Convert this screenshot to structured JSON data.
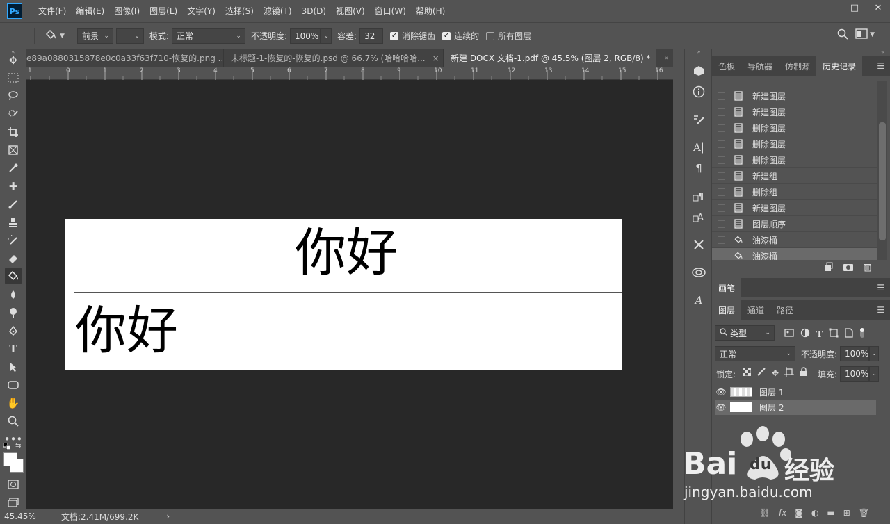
{
  "app": {
    "logo": "Ps"
  },
  "menu": [
    "文件(F)",
    "编辑(E)",
    "图像(I)",
    "图层(L)",
    "文字(Y)",
    "选择(S)",
    "滤镜(T)",
    "3D(D)",
    "视图(V)",
    "窗口(W)",
    "帮助(H)"
  ],
  "window_controls": {
    "minimize": "—",
    "maximize": "□",
    "close": "✕"
  },
  "options": {
    "fill_source": "前景",
    "mode_label": "模式:",
    "mode_value": "正常",
    "opacity_label": "不透明度:",
    "opacity_value": "100%",
    "tolerance_label": "容差:",
    "tolerance_value": "32",
    "antialias_label": "消除锯齿",
    "antialias_checked": true,
    "contiguous_label": "连续的",
    "contiguous_checked": true,
    "all_layers_label": "所有图层",
    "all_layers_checked": false
  },
  "tabs": [
    {
      "label": "e89a0880315878e0c0a33f63f710-恢复的.png ...",
      "close": "×",
      "active": false
    },
    {
      "label": "未标题-1-恢复的-恢复的.psd @ 66.7% (哈哈哈哈...",
      "close": "×",
      "active": false
    },
    {
      "label": "新建 DOCX 文档-1.pdf @ 45.5% (图层 2, RGB/8) *",
      "close": "×",
      "active": true
    }
  ],
  "ruler_ticks": [
    "1",
    "0",
    "1",
    "2",
    "3",
    "4",
    "5",
    "6",
    "7",
    "8",
    "9",
    "10",
    "11",
    "12",
    "13",
    "14",
    "15",
    "16"
  ],
  "document": {
    "title_text": "你好",
    "body_text": "你好"
  },
  "status": {
    "zoom": "45.45%",
    "doc_info": "文档:2.41M/699.2K",
    "arrow": "›"
  },
  "history_panel": {
    "tabs": [
      "色板",
      "导航器",
      "仿制源",
      "历史记录"
    ],
    "active_tab": "历史记录",
    "items": [
      "新建图层",
      "新建图层",
      "删除图层",
      "删除图层",
      "删除图层",
      "新建组",
      "删除组",
      "新建图层",
      "图层顺序",
      "油漆桶",
      "油漆桶"
    ],
    "selected_index": 10
  },
  "brush_panel": {
    "title": "画笔"
  },
  "layers_panel": {
    "tabs": [
      "图层",
      "通道",
      "路径"
    ],
    "active_tab": "图层",
    "filter_label": "类型",
    "blend_mode": "正常",
    "opacity_label": "不透明度:",
    "opacity_value": "100%",
    "lock_label": "锁定:",
    "fill_label": "填充:",
    "fill_value": "100%",
    "layers": [
      {
        "name": "图层 1",
        "selected": false
      },
      {
        "name": "图层 2",
        "selected": true
      }
    ]
  },
  "watermark": {
    "brand": "Bai",
    "brand2": "du",
    "suffix": "经验",
    "url": "jingyan.baidu.com"
  }
}
